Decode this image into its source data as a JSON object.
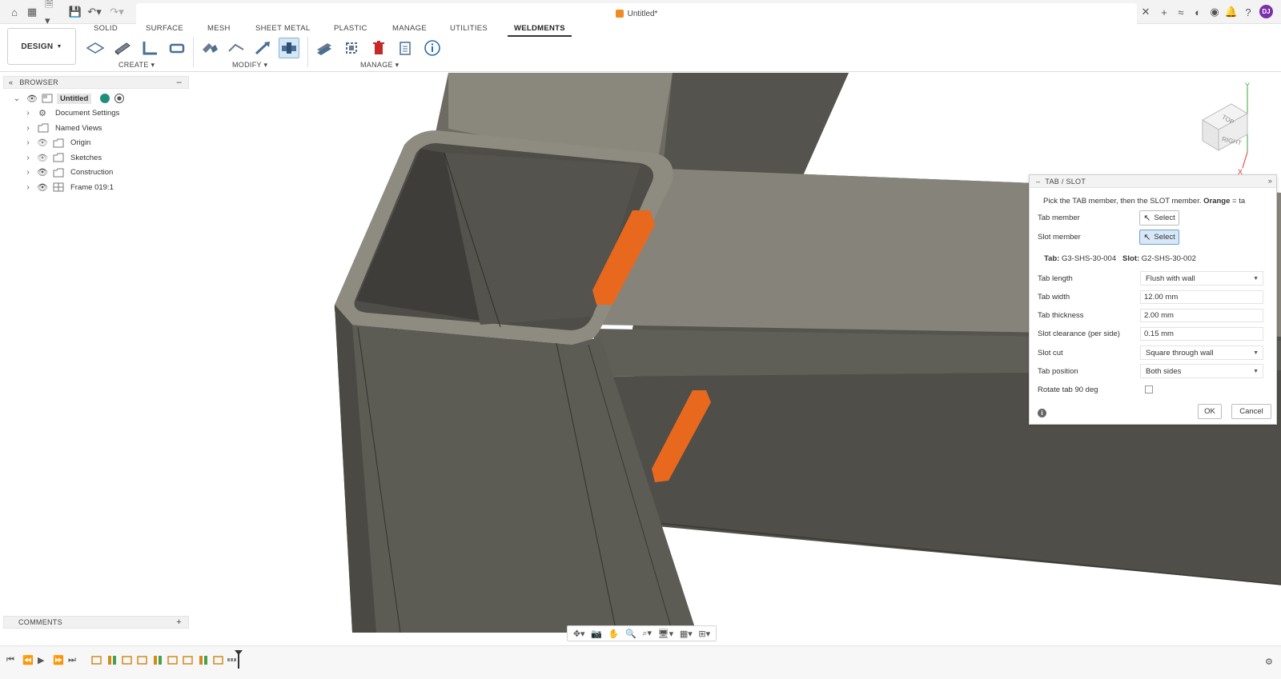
{
  "titlebar": {
    "document_title": "Untitled*",
    "avatar_initials": "DJ"
  },
  "workspace": {
    "label": "DESIGN"
  },
  "ribbon": {
    "tabs": [
      "SOLID",
      "SURFACE",
      "MESH",
      "SHEET METAL",
      "PLASTIC",
      "MANAGE",
      "UTILITIES",
      "WELDMENTS"
    ],
    "active_tab": "WELDMENTS",
    "groups": {
      "create": "CREATE",
      "modify": "MODIFY",
      "manage": "MANAGE"
    }
  },
  "browser": {
    "title": "BROWSER",
    "root": "Untitled",
    "items": [
      {
        "label": "Document Settings",
        "icon": "gear-icon"
      },
      {
        "label": "Named Views",
        "icon": "folder-icon"
      },
      {
        "label": "Origin",
        "icon": "folder-icon"
      },
      {
        "label": "Sketches",
        "icon": "folder-icon"
      },
      {
        "label": "Construction",
        "icon": "folder-icon"
      },
      {
        "label": "Frame 019:1",
        "icon": "component-icon"
      }
    ]
  },
  "comments": {
    "title": "COMMENTS"
  },
  "viewcube": {
    "top": "TOP",
    "right": "RIGHT",
    "axis_y": "Y",
    "axis_x": "X"
  },
  "dialog": {
    "title": "TAB / SLOT",
    "instruction_prefix": "Pick the TAB member, then the SLOT member.",
    "instruction_bold": "Orange",
    "instruction_suffix": "= ta",
    "tab_member_label": "Tab member",
    "slot_member_label": "Slot member",
    "select_label": "Select",
    "tab_info_label": "Tab:",
    "tab_info_value": "G3-SHS-30-004",
    "slot_info_label": "Slot:",
    "slot_info_value": "G2-SHS-30-002",
    "fields": {
      "tab_length": {
        "label": "Tab length",
        "value": "Flush with wall"
      },
      "tab_width": {
        "label": "Tab width",
        "value": "12.00 mm"
      },
      "tab_thickness": {
        "label": "Tab thickness",
        "value": "2.00 mm"
      },
      "slot_clearance": {
        "label": "Slot clearance (per side)",
        "value": "0.15 mm"
      },
      "slot_cut": {
        "label": "Slot cut",
        "value": "Square through wall"
      },
      "tab_position": {
        "label": "Tab position",
        "value": "Both sides"
      },
      "rotate_tab": {
        "label": "Rotate tab 90 deg",
        "checked": false
      }
    },
    "ok_label": "OK",
    "cancel_label": "Cancel"
  },
  "colors": {
    "accent_orange": "#e8681e",
    "steel": "#5b5a53",
    "selected_blue": "#d7e7f6"
  }
}
